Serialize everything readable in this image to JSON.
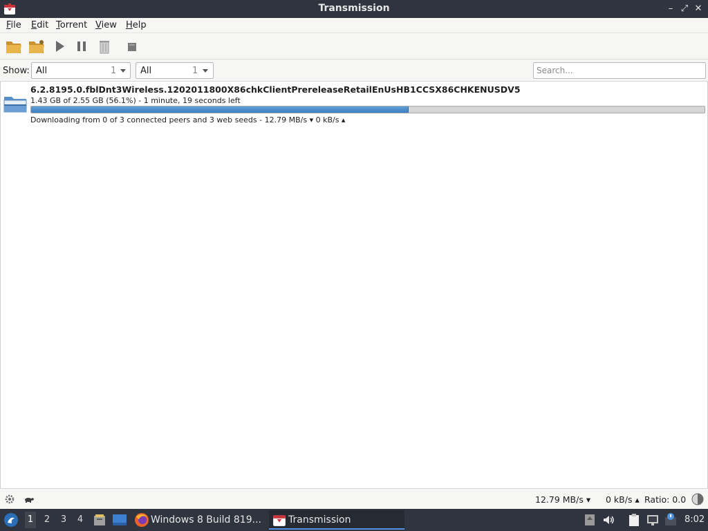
{
  "window": {
    "title": "Transmission",
    "controls": {
      "minimize": "–",
      "maximize": "⤢",
      "close": "✕"
    }
  },
  "menu": {
    "items": [
      {
        "label": "File",
        "ul": "F",
        "rest": "ile"
      },
      {
        "label": "Edit",
        "ul": "E",
        "rest": "dit"
      },
      {
        "label": "Torrent",
        "ul": "T",
        "rest": "orrent"
      },
      {
        "label": "View",
        "ul": "V",
        "rest": "iew"
      },
      {
        "label": "Help",
        "ul": "H",
        "rest": "elp"
      }
    ]
  },
  "toolbar": {
    "buttons": [
      "open-folder-icon",
      "open-url-icon",
      "start-icon",
      "pause-icon",
      "remove-icon",
      "properties-icon"
    ]
  },
  "filter": {
    "show_label": "Show:",
    "activity": {
      "value": "All",
      "count": "1"
    },
    "tracker": {
      "value": "All",
      "count": "1"
    },
    "search_placeholder": "Search..."
  },
  "torrent": {
    "name": "6.2.8195.0.fblDnt3Wireless.1202011800X86chkClientPrereleaseRetailEnUsHB1CCSX86CHKENUSDV5",
    "progress_text": "1.43 GB of 2.55 GB (56.1%) - 1 minute, 19 seconds left",
    "progress_fraction": 0.561,
    "status": "Downloading from 0 of 3 connected peers and 3 web seeds - 12.79 MB/s ▾   0 kB/s ▴"
  },
  "statusbar": {
    "download_speed": "12.79 MB/s ▾",
    "upload_speed": "0 kB/s ▴",
    "ratio": "Ratio: 0.0"
  },
  "taskbar": {
    "workspaces": [
      "1",
      "2",
      "3",
      "4"
    ],
    "active_workspace": "1",
    "tasks": [
      {
        "label": "Windows 8 Build 819..."
      },
      {
        "label": "Transmission"
      }
    ],
    "clock": "8:02"
  },
  "colors": {
    "titlebar": "#2f343f",
    "progress": "#4a8bc9",
    "accent": "#5294e2"
  }
}
